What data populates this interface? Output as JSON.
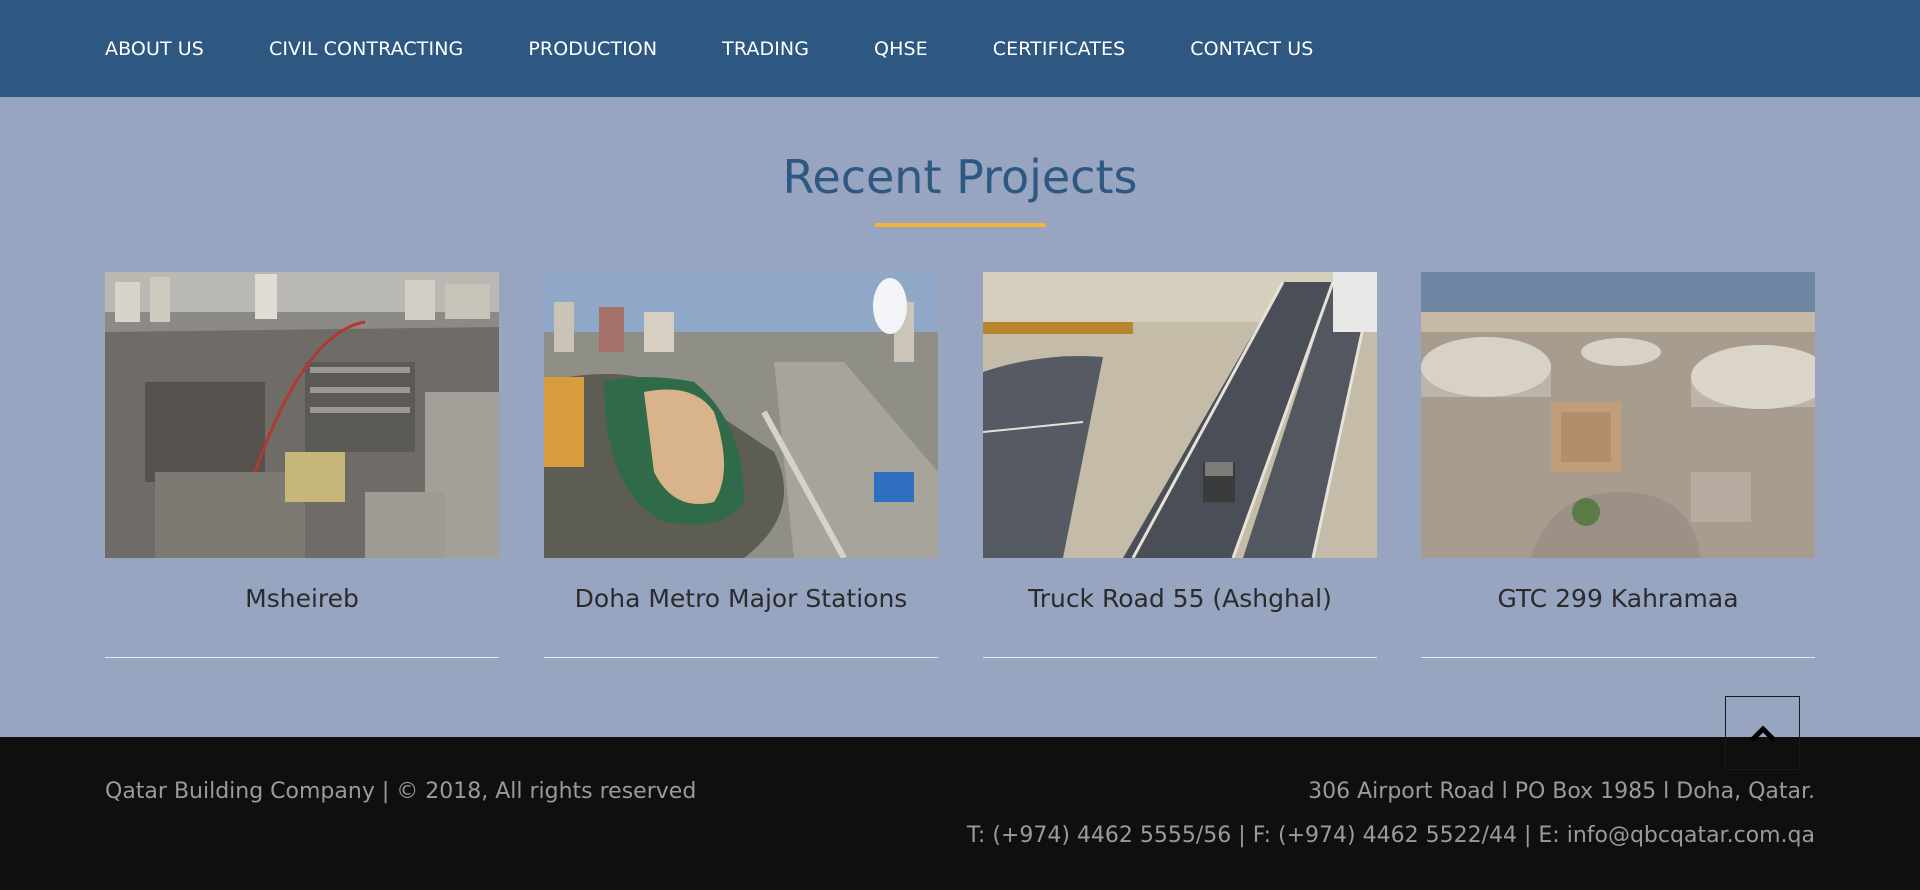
{
  "nav": {
    "items": [
      {
        "label": "ABOUT US"
      },
      {
        "label": "CIVIL CONTRACTING"
      },
      {
        "label": "PRODUCTION"
      },
      {
        "label": "TRADING"
      },
      {
        "label": "QHSE"
      },
      {
        "label": "CERTIFICATES"
      },
      {
        "label": "CONTACT US"
      }
    ]
  },
  "section": {
    "title": "Recent Projects"
  },
  "projects": [
    {
      "title": "Msheireb"
    },
    {
      "title": "Doha Metro Major Stations"
    },
    {
      "title": "Truck Road 55 (Ashghal)"
    },
    {
      "title": "GTC 299 Kahramaa"
    }
  ],
  "footer": {
    "copyright": "Qatar Building Company | © 2018, All rights reserved",
    "address": "306 Airport Road l PO Box 1985 l Doha, Qatar.",
    "contact": "T: (+974) 4462 5555/56 | F: (+974) 4462 5522/44 | E: info@qbcqatar.com.qa"
  },
  "colors": {
    "nav_bg": "#2e5882",
    "page_bg": "#98a5c0",
    "accent_underline": "#f2b33d",
    "footer_bg": "#0f0f0f"
  },
  "icons": {
    "back_to_top": "chevron-up-icon"
  }
}
